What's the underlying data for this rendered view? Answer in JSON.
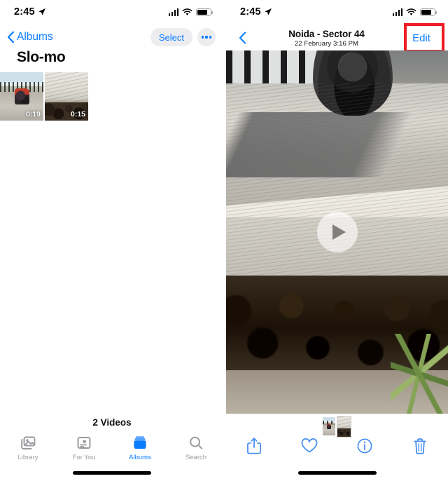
{
  "accent_color": "#0a7cff",
  "highlight_color": "#ee1c24",
  "inactive_color": "#9a9a9f",
  "left_screen": {
    "status": {
      "time": "2:45",
      "location_icon": "location-arrow-icon",
      "cellular_icon": "cellular-bars-icon",
      "wifi_icon": "wifi-icon",
      "battery_icon": "battery-icon"
    },
    "nav": {
      "back_label": "Albums",
      "back_icon": "chevron-left-icon",
      "select_label": "Select",
      "more_icon": "ellipsis-icon"
    },
    "title": "Slo-mo",
    "thumbnails": [
      {
        "duration": "0:19",
        "art": "scooter-on-road"
      },
      {
        "duration": "0:15",
        "art": "gravel-road"
      }
    ],
    "count_label": "2 Videos",
    "tabs": [
      {
        "label": "Library",
        "icon": "library-icon",
        "active": false
      },
      {
        "label": "For You",
        "icon": "for-you-icon",
        "active": false
      },
      {
        "label": "Albums",
        "icon": "albums-icon",
        "active": true
      },
      {
        "label": "Search",
        "icon": "search-icon",
        "active": false
      }
    ],
    "home_indicator": "home-indicator"
  },
  "right_screen": {
    "status": {
      "time": "2:45",
      "location_icon": "location-arrow-icon",
      "cellular_icon": "cellular-bars-icon",
      "wifi_icon": "wifi-icon",
      "battery_icon": "battery-icon"
    },
    "nav": {
      "back_icon": "chevron-left-icon",
      "title": "Noida - Sector 44",
      "subtitle": "22 February  3:16 PM",
      "edit_label": "Edit",
      "edit_highlighted": true
    },
    "media": {
      "type": "video",
      "play_icon": "play-icon",
      "description": "Truck tire on dusty road with gravel and plants"
    },
    "filmstrip": [
      {
        "selected": false,
        "art": "scooter-on-road"
      },
      {
        "selected": true,
        "art": "gravel-road"
      }
    ],
    "toolbar": [
      {
        "name": "share",
        "icon": "share-icon"
      },
      {
        "name": "favorite",
        "icon": "heart-icon"
      },
      {
        "name": "info",
        "icon": "info-icon"
      },
      {
        "name": "delete",
        "icon": "trash-icon"
      }
    ],
    "home_indicator": "home-indicator"
  }
}
